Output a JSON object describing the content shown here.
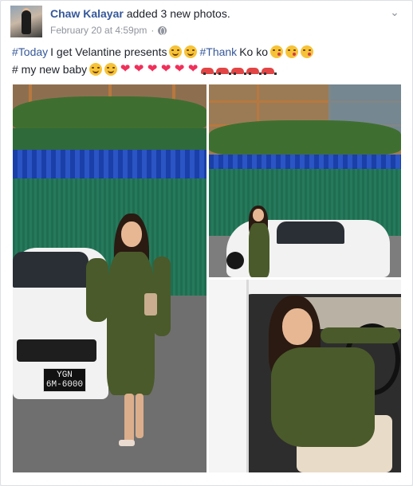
{
  "post": {
    "author": "Chaw Kalayar",
    "action_prefix": "added",
    "photo_count": "3",
    "action_suffix": "new photos.",
    "timestamp": "February 20 at 4:59pm",
    "separator": "·",
    "privacy_icon": "globe-icon",
    "menu_icon": "chevron-down-icon"
  },
  "message": {
    "line1": {
      "hashtag1": "#Today",
      "text1": "I get Velantine presents",
      "hashtag2": "#Thank",
      "text2": "Ko ko"
    },
    "line2": {
      "text": "# my new baby"
    }
  },
  "photos": {
    "plate_line1": "YGN",
    "plate_line2": "6M-6000"
  },
  "colors": {
    "link": "#365899",
    "text": "#1d2129",
    "meta": "#90949c",
    "heart": "#f0305a",
    "car_emoji": "#e24545"
  }
}
